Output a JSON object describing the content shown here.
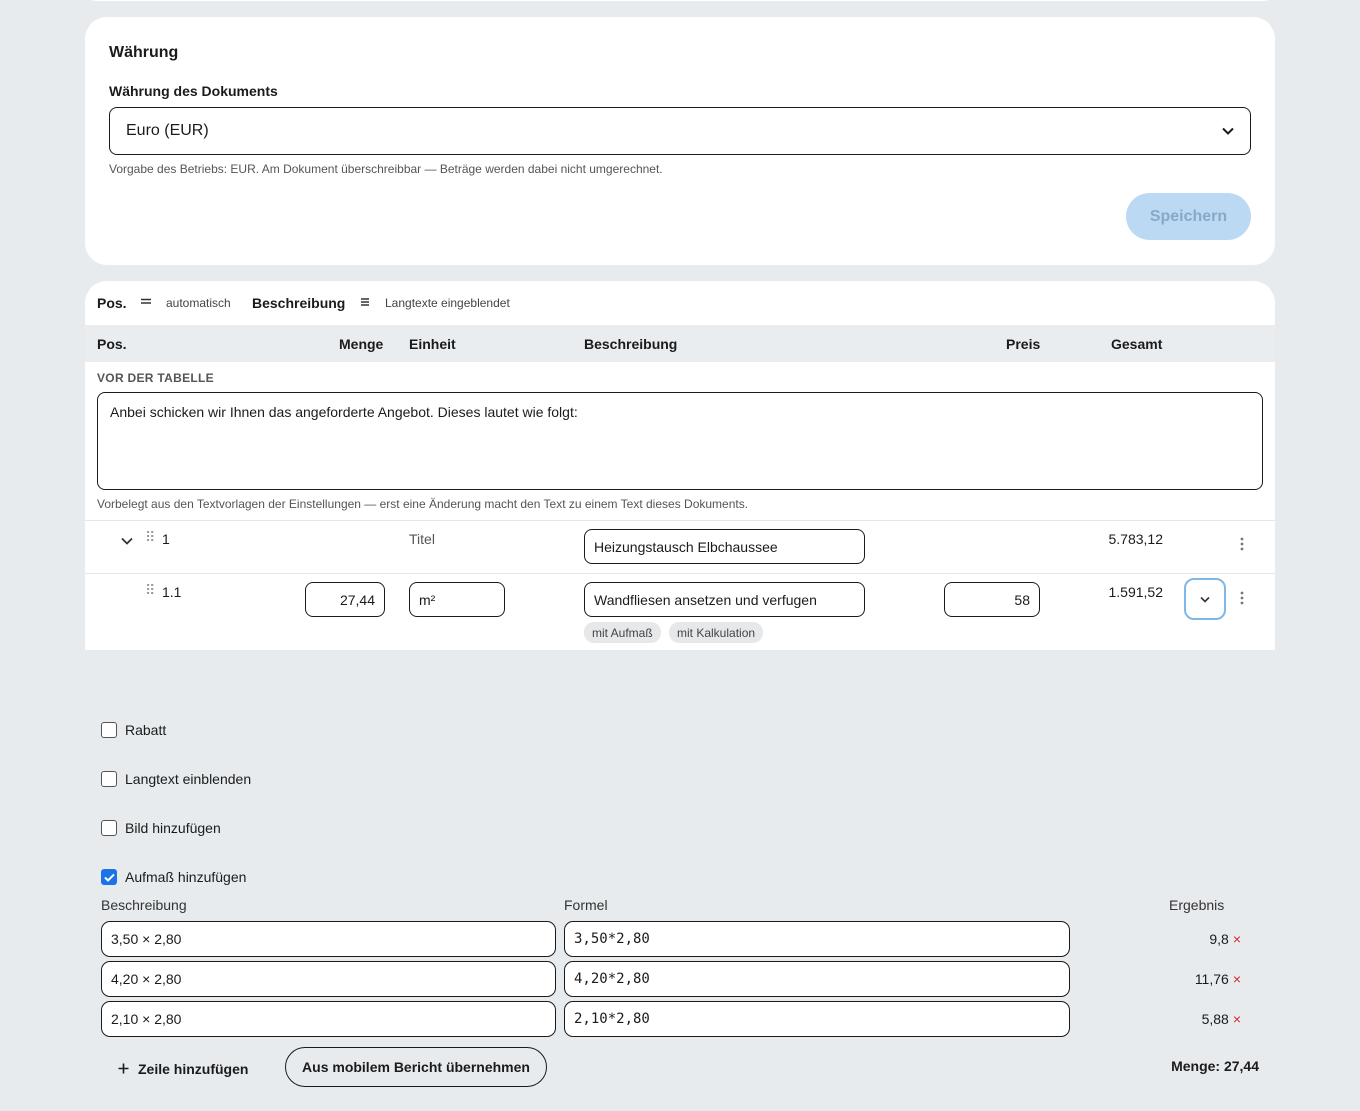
{
  "currency": {
    "title": "Währung",
    "label": "Währung des Dokuments",
    "selected": "Euro (EUR)",
    "hint": "Vorgabe des Betriebs: EUR. Am Dokument überschreibbar — Beträge werden dabei nicht umgerechnet.",
    "save_label": "Speichern"
  },
  "toolbar": {
    "pos_label": "Pos.",
    "pos_mode": "automatisch",
    "desc_label": "Beschreibung",
    "desc_mode": "Langtexte eingeblendet"
  },
  "table": {
    "headers": {
      "pos": "Pos.",
      "menge": "Menge",
      "einheit": "Einheit",
      "beschreibung": "Beschreibung",
      "preis": "Preis",
      "gesamt": "Gesamt"
    },
    "pre_label": "VOR DER TABELLE",
    "pre_text": "Anbei schicken wir Ihnen das angeforderte Angebot. Dieses lautet wie folgt:",
    "pre_hint": "Vorbelegt aus den Textvorlagen der Einstellungen — erst eine Änderung macht den Text zu einem Text dieses Dokuments.",
    "title_row": {
      "pos": "1",
      "type": "Titel",
      "description": "Heizungstausch Elbchaussee",
      "total": "5.783,12"
    },
    "item_row": {
      "pos": "1.1",
      "menge": "27,44",
      "einheit": "m²",
      "description": "Wandfliesen ansetzen und verfugen",
      "preis": "58",
      "total": "1.591,52",
      "tags": [
        "mit Aufmaß",
        "mit Kalkulation"
      ]
    }
  },
  "options": {
    "rabatt": "Rabatt",
    "langtext": "Langtext einblenden",
    "bild": "Bild hinzufügen",
    "aufmass": "Aufmaß hinzufügen"
  },
  "measure": {
    "headers": {
      "beschreibung": "Beschreibung",
      "formel": "Formel",
      "ergebnis": "Ergebnis"
    },
    "rows": [
      {
        "beschreibung": "3,50 × 2,80",
        "formel": "3,50*2,80",
        "ergebnis": "9,8"
      },
      {
        "beschreibung": "4,20 × 2,80",
        "formel": "4,20*2,80",
        "ergebnis": "11,76"
      },
      {
        "beschreibung": "2,10 × 2,80",
        "formel": "2,10*2,80",
        "ergebnis": "5,88"
      }
    ],
    "add_row": "Zeile hinzufügen",
    "mobile_button": "Aus mobilem Bericht übernehmen",
    "menge_total": "Menge: 27,44",
    "delete_glyph": "×"
  }
}
